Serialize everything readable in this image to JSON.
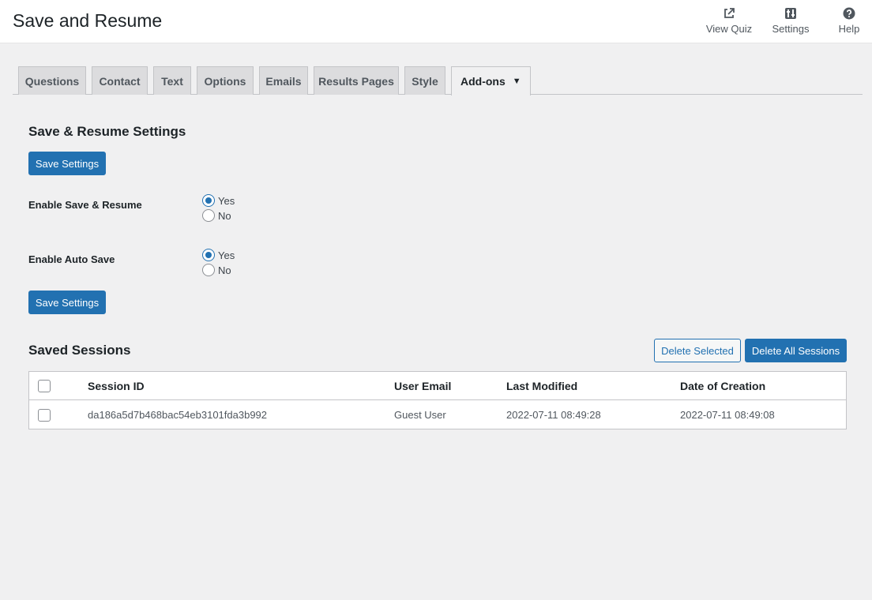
{
  "header": {
    "title": "Save and Resume",
    "actions": [
      {
        "label": "View Quiz",
        "icon": "external-link-icon"
      },
      {
        "label": "Settings",
        "icon": "settings-sliders-icon"
      },
      {
        "label": "Help",
        "icon": "help-icon"
      }
    ]
  },
  "tabs": [
    {
      "label": "Questions"
    },
    {
      "label": "Contact"
    },
    {
      "label": "Text"
    },
    {
      "label": "Options"
    },
    {
      "label": "Emails"
    },
    {
      "label": "Results Pages"
    },
    {
      "label": "Style"
    },
    {
      "label": "Add-ons",
      "active": true,
      "caret": "▼"
    }
  ],
  "settings": {
    "title": "Save & Resume Settings",
    "save_label": "Save Settings",
    "fields": [
      {
        "label": "Enable Save & Resume",
        "options": [
          "Yes",
          "No"
        ],
        "selected": "Yes"
      },
      {
        "label": "Enable Auto Save",
        "options": [
          "Yes",
          "No"
        ],
        "selected": "Yes"
      }
    ]
  },
  "sessions": {
    "title": "Saved Sessions",
    "delete_selected_label": "Delete Selected",
    "delete_all_label": "Delete All Sessions",
    "columns": [
      "Session ID",
      "User Email",
      "Last Modified",
      "Date of Creation"
    ],
    "rows": [
      [
        "da186a5d7b468bac54eb3101fda3b992",
        "Guest User",
        "2022-07-11 08:49:28",
        "2022-07-11 08:49:08"
      ]
    ]
  },
  "colors": {
    "primary": "#2271b1",
    "background": "#f0f0f1",
    "tab_inactive": "#dcdcde"
  }
}
